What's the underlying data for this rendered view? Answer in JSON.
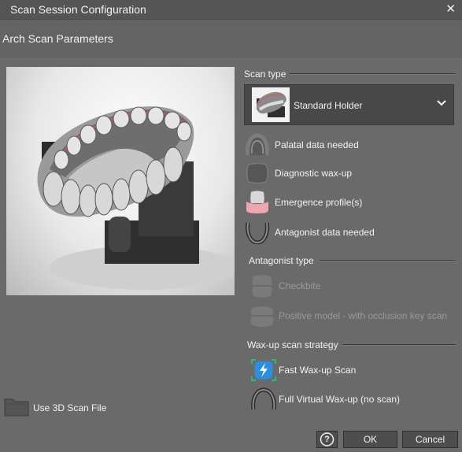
{
  "window": {
    "title": "Scan Session Configuration",
    "close_glyph": "✕"
  },
  "header": {
    "title": "Arch Scan Parameters",
    "arch_icon": "full-arch-icon"
  },
  "scan_type": {
    "section_label": "Scan type",
    "selected": "Standard Holder",
    "options": [
      {
        "label": "Palatal data needed",
        "icon": "palate-icon",
        "enabled": true
      },
      {
        "label": "Diagnostic wax-up",
        "icon": "wax-up-icon",
        "enabled": true
      },
      {
        "label": "Emergence profile(s)",
        "icon": "gingiva-icon",
        "enabled": true
      },
      {
        "label": "Antagonist data needed",
        "icon": "antagonist-arch-icon",
        "enabled": true
      }
    ]
  },
  "antagonist_type": {
    "section_label": "Antagonist type",
    "options": [
      {
        "label": "Checkbite",
        "icon": "checkbite-icon",
        "enabled": false
      },
      {
        "label": "Positive model - with occlusion key scan",
        "icon": "positive-model-icon",
        "enabled": false
      }
    ]
  },
  "waxup_strategy": {
    "section_label": "Wax-up scan strategy",
    "options": [
      {
        "label": "Fast Wax-up Scan",
        "icon": "fast-scan-icon",
        "selected": true
      },
      {
        "label": "Full Virtual Wax-up (no scan)",
        "icon": "virtual-wax-up-icon",
        "selected": false
      }
    ]
  },
  "use_file": {
    "label": "Use 3D Scan File",
    "icon": "folder-icon"
  },
  "footer": {
    "help_glyph": "?",
    "ok_label": "OK",
    "cancel_label": "Cancel"
  },
  "colors": {
    "accent": "#22c07a",
    "gingiva": "#f0a6b0",
    "fast_scan": "#2a8fe0"
  }
}
